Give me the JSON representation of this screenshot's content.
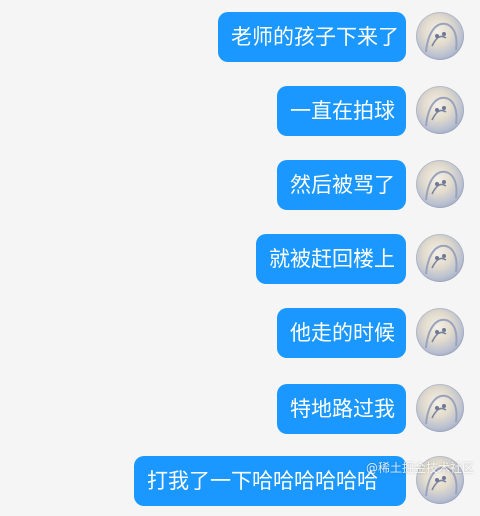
{
  "chat": {
    "messages": [
      {
        "text": "老师的孩子下来了"
      },
      {
        "text": "一直在拍球"
      },
      {
        "text": "然后被骂了"
      },
      {
        "text": "就被赶回楼上"
      },
      {
        "text": "他走的时候"
      },
      {
        "text": "特地路过我"
      },
      {
        "text": "打我了一下哈哈哈哈哈哈"
      }
    ]
  },
  "colors": {
    "bubble": "#1a98ff",
    "background": "#f5f5f5"
  },
  "icons": {
    "avatar": "anime-avatar-icon"
  },
  "watermark": "@稀土掘金技术社区"
}
